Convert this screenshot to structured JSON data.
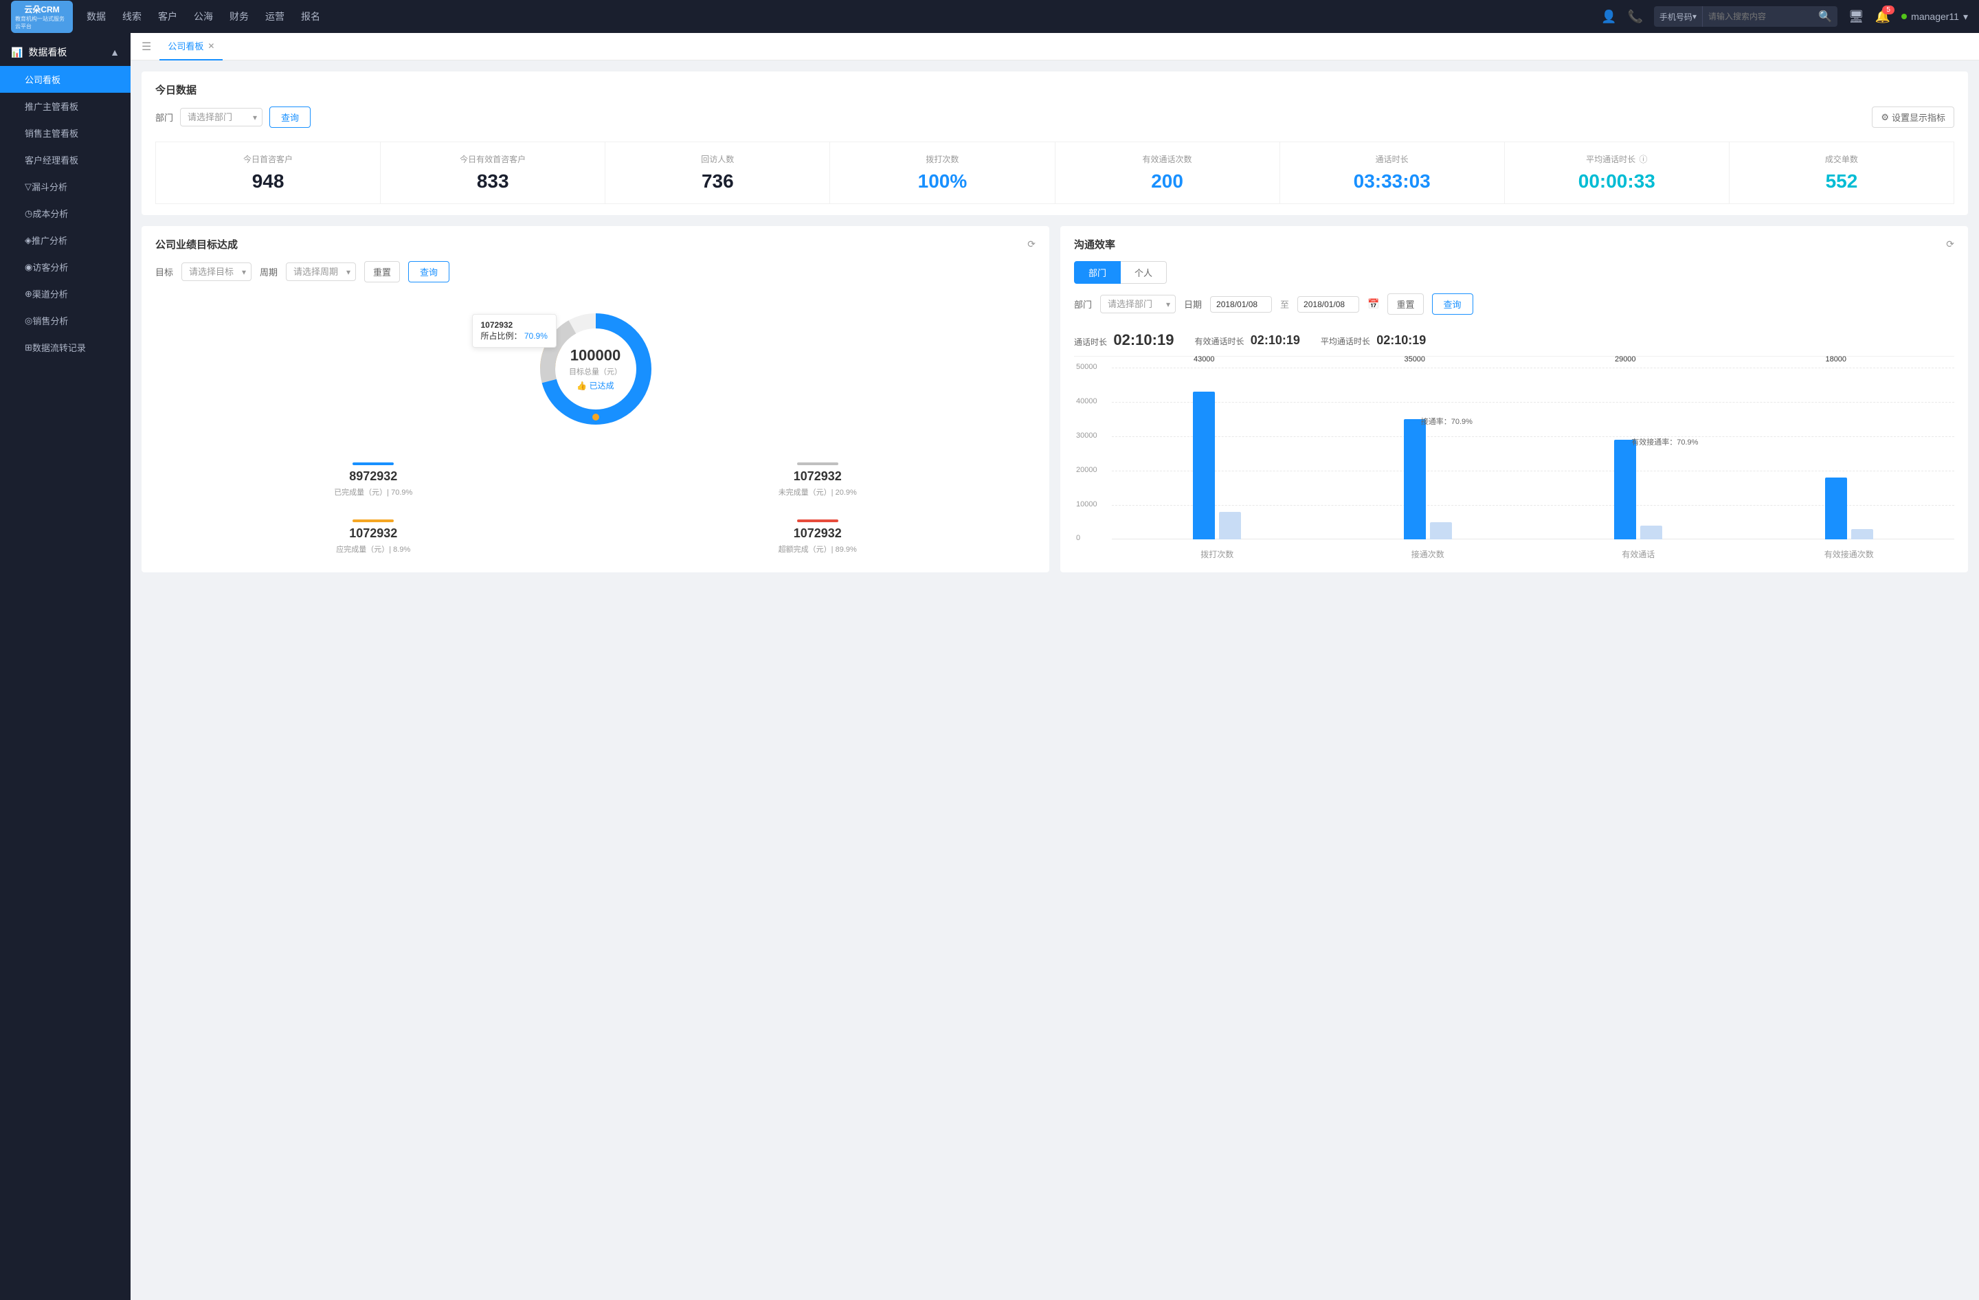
{
  "app": {
    "logo_line1": "云朵CRM",
    "logo_line2": "教育机构一站式服务云平台"
  },
  "nav": {
    "links": [
      "数据",
      "线索",
      "客户",
      "公海",
      "财务",
      "运营",
      "报名"
    ],
    "search": {
      "type": "手机号码",
      "placeholder": "请输入搜索内容"
    },
    "badge": "5",
    "username": "manager11"
  },
  "sidebar": {
    "section_label": "数据看板",
    "items": [
      {
        "label": "公司看板",
        "active": true
      },
      {
        "label": "推广主管看板",
        "active": false
      },
      {
        "label": "销售主管看板",
        "active": false
      },
      {
        "label": "客户经理看板",
        "active": false
      },
      {
        "label": "漏斗分析",
        "active": false
      },
      {
        "label": "成本分析",
        "active": false
      },
      {
        "label": "推广分析",
        "active": false
      },
      {
        "label": "访客分析",
        "active": false
      },
      {
        "label": "渠道分析",
        "active": false
      },
      {
        "label": "销售分析",
        "active": false
      },
      {
        "label": "数据流转记录",
        "active": false
      }
    ]
  },
  "tabs": {
    "items": [
      {
        "label": "公司看板",
        "closable": true
      }
    ]
  },
  "today_data": {
    "title": "今日数据",
    "filter": {
      "label": "部门",
      "placeholder": "请选择部门",
      "query_btn": "查询",
      "settings_btn": "设置显示指标"
    },
    "stats": [
      {
        "label": "今日首咨客户",
        "value": "948",
        "color": "black"
      },
      {
        "label": "今日有效首咨客户",
        "value": "833",
        "color": "black"
      },
      {
        "label": "回访人数",
        "value": "736",
        "color": "black"
      },
      {
        "label": "拨打次数",
        "value": "100%",
        "color": "blue"
      },
      {
        "label": "有效通话次数",
        "value": "200",
        "color": "blue"
      },
      {
        "label": "通话时长",
        "value": "03:33:03",
        "color": "blue"
      },
      {
        "label": "平均通话时长",
        "value": "00:00:33",
        "color": "cyan"
      },
      {
        "label": "成交单数",
        "value": "552",
        "color": "cyan"
      }
    ]
  },
  "company_target": {
    "title": "公司业绩目标达成",
    "filters": {
      "target_label": "目标",
      "target_placeholder": "请选择目标",
      "period_label": "周期",
      "period_placeholder": "请选择周期",
      "reset_btn": "重置",
      "query_btn": "查询"
    },
    "donut": {
      "tooltip_value": "1072932",
      "tooltip_pct_label": "所占比例：",
      "tooltip_pct": "70.9%",
      "center_num": "100000",
      "center_label": "目标总量（元）",
      "center_status": "👍 已达成"
    },
    "stats": [
      {
        "label": "已完成量（元）| 70.9%",
        "value": "8972932",
        "bar_color": "#1890ff"
      },
      {
        "label": "未完成量（元）| 20.9%",
        "value": "1072932",
        "bar_color": "#c0c0c0"
      },
      {
        "label": "应完成量（元）| 8.9%",
        "value": "1072932",
        "bar_color": "#f5a623"
      },
      {
        "label": "超额完成（元）| 89.9%",
        "value": "1072932",
        "bar_color": "#e74c3c"
      }
    ]
  },
  "comm_efficiency": {
    "title": "沟通效率",
    "tabs": [
      "部门",
      "个人"
    ],
    "active_tab": 0,
    "filter": {
      "dept_label": "部门",
      "dept_placeholder": "请选择部门",
      "date_label": "日期",
      "date_from": "2018/01/08",
      "date_to": "2018/01/08",
      "date_sep": "至",
      "reset_btn": "重置",
      "query_btn": "查询"
    },
    "stats": {
      "call_duration_label": "通话时长",
      "call_duration_val": "02:10:19",
      "effective_label": "有效通话时长",
      "effective_val": "02:10:19",
      "avg_label": "平均通话时长",
      "avg_val": "02:10:19"
    },
    "chart": {
      "y_labels": [
        "50000",
        "40000",
        "30000",
        "20000",
        "10000",
        "0"
      ],
      "groups": [
        {
          "x_label": "拨打次数",
          "bars": [
            {
              "value": 43000,
              "label": "43000",
              "color": "#1890ff",
              "height_pct": 86
            },
            {
              "value": 8000,
              "label": "",
              "color": "#c0d8f5",
              "height_pct": 16
            }
          ],
          "annotation": ""
        },
        {
          "x_label": "接通次数",
          "bars": [
            {
              "value": 35000,
              "label": "35000",
              "color": "#1890ff",
              "height_pct": 70
            },
            {
              "value": 5000,
              "label": "",
              "color": "#c0d8f5",
              "height_pct": 10
            }
          ],
          "annotation": "接通率：70.9%"
        },
        {
          "x_label": "有效通话",
          "bars": [
            {
              "value": 29000,
              "label": "29000",
              "color": "#1890ff",
              "height_pct": 58
            },
            {
              "value": 4000,
              "label": "",
              "color": "#c0d8f5",
              "height_pct": 8
            }
          ],
          "annotation": "有效接通率：70.9%"
        },
        {
          "x_label": "有效接通次数",
          "bars": [
            {
              "value": 18000,
              "label": "18000",
              "color": "#1890ff",
              "height_pct": 36
            },
            {
              "value": 3000,
              "label": "",
              "color": "#c0d8f5",
              "height_pct": 6
            }
          ],
          "annotation": ""
        }
      ]
    }
  }
}
